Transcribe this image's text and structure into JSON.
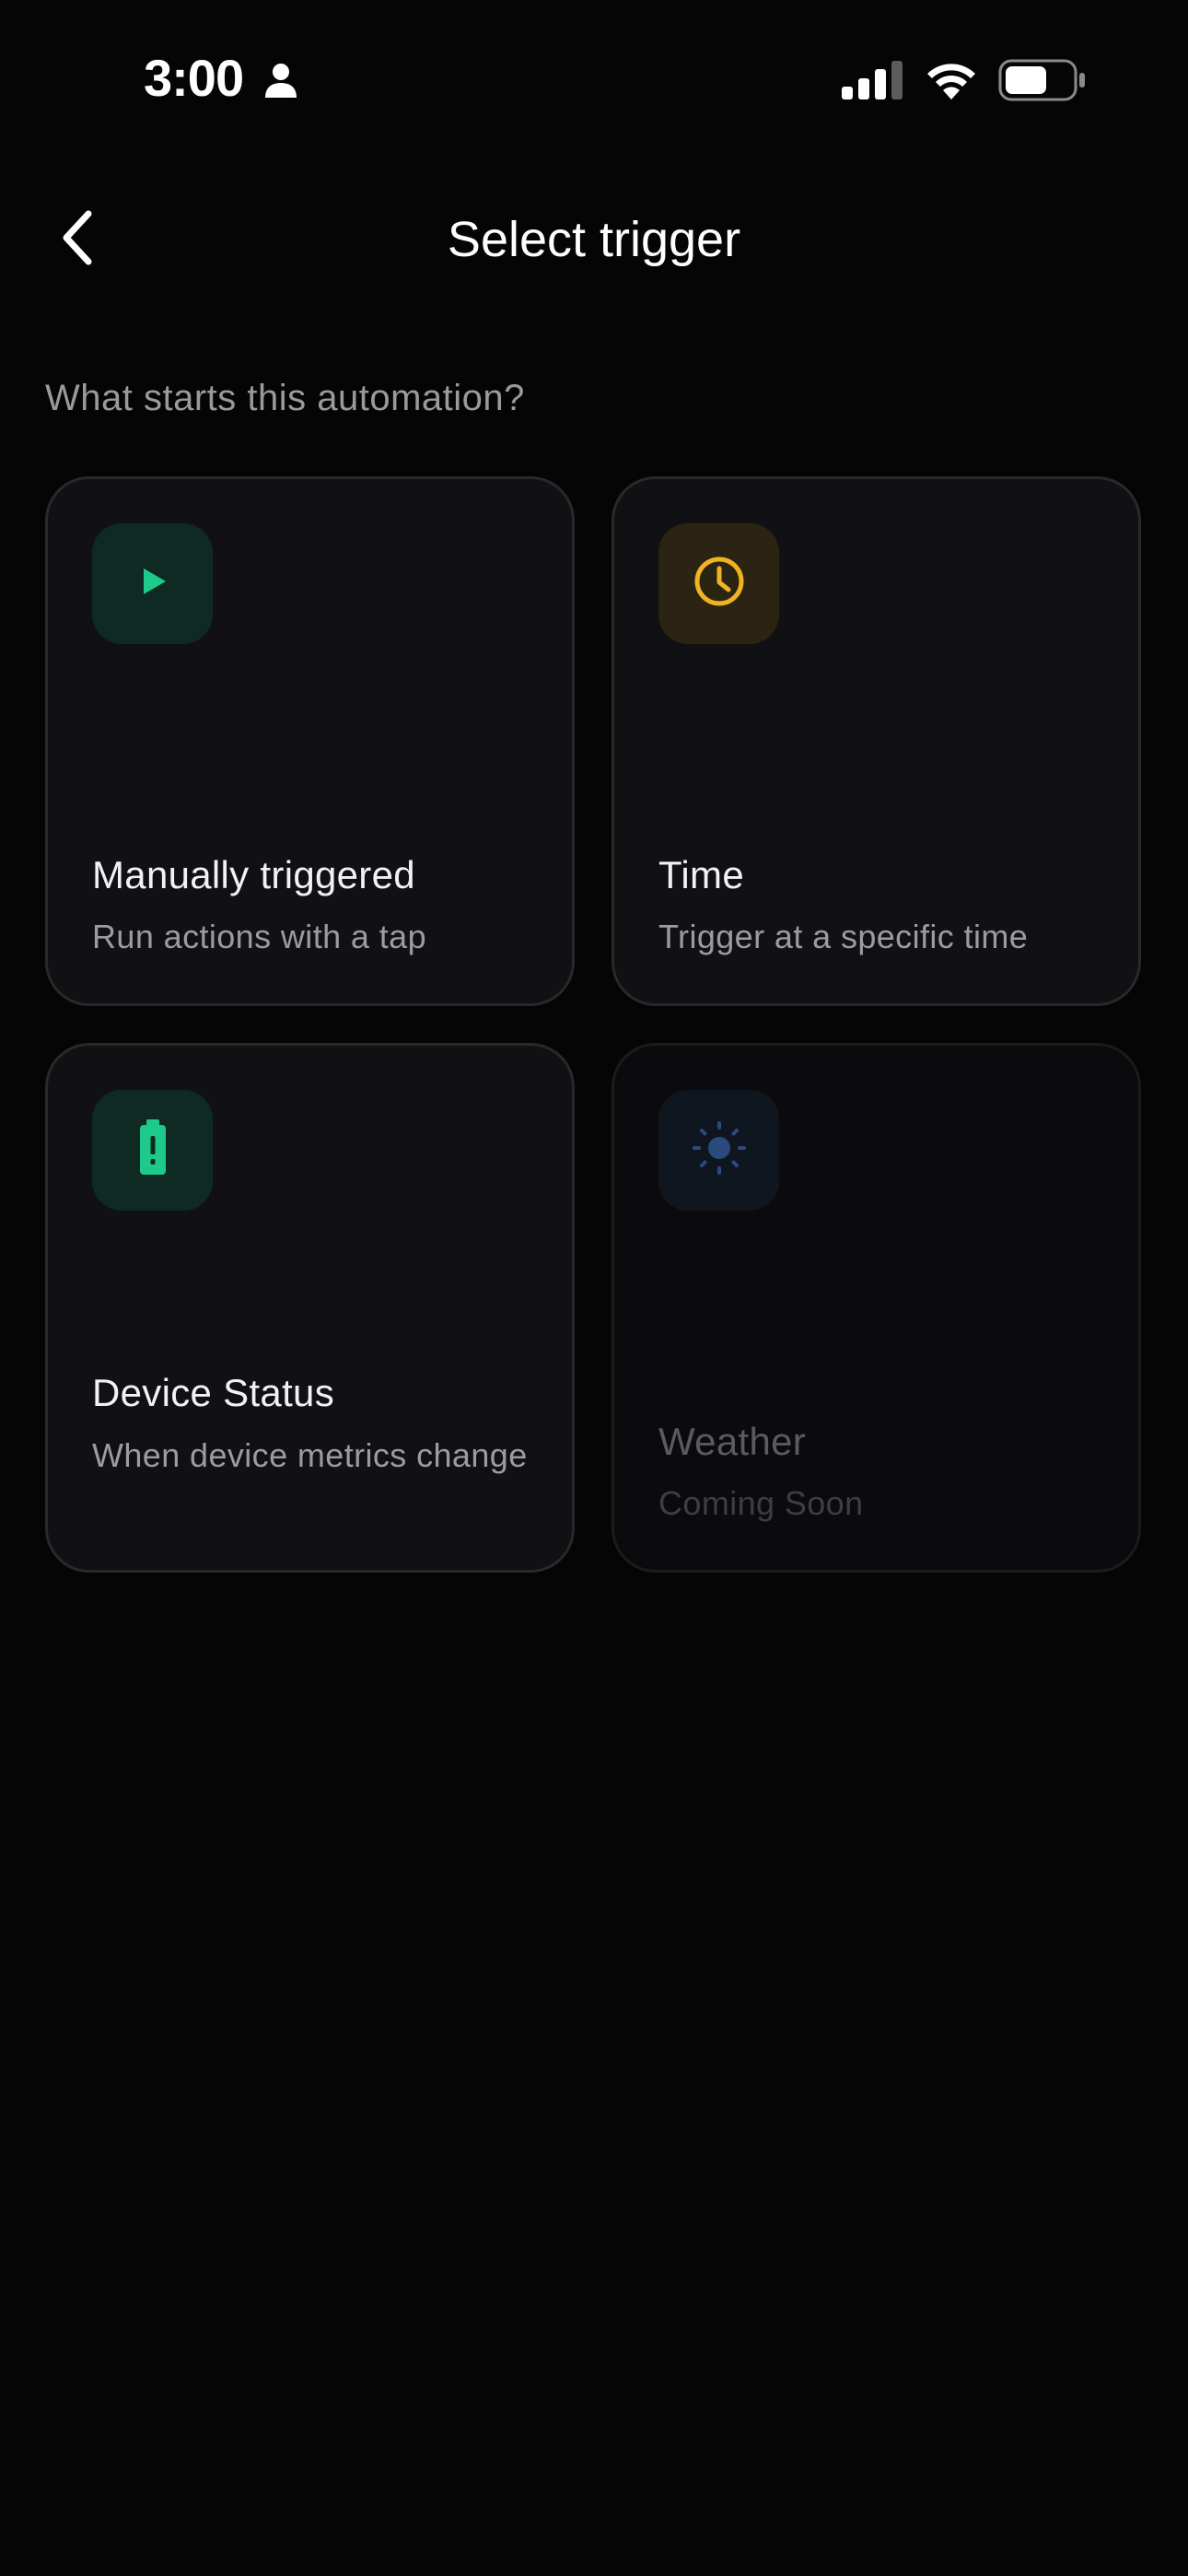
{
  "status_bar": {
    "time": "3:00"
  },
  "header": {
    "title": "Select trigger"
  },
  "prompt": "What starts this automation?",
  "triggers": [
    {
      "title": "Manually triggered",
      "subtitle": "Run actions with a tap",
      "icon": "play-icon",
      "accent": "#1ec98c",
      "enabled": true
    },
    {
      "title": "Time",
      "subtitle": "Trigger at a specific time",
      "icon": "clock-icon",
      "accent": "#f0b323",
      "enabled": true
    },
    {
      "title": "Device Status",
      "subtitle": "When device metrics change",
      "icon": "battery-alert-icon",
      "accent": "#1ec98c",
      "enabled": true
    },
    {
      "title": "Weather",
      "subtitle": "Coming Soon",
      "icon": "sun-icon",
      "accent": "#2b4a7e",
      "enabled": false
    }
  ]
}
